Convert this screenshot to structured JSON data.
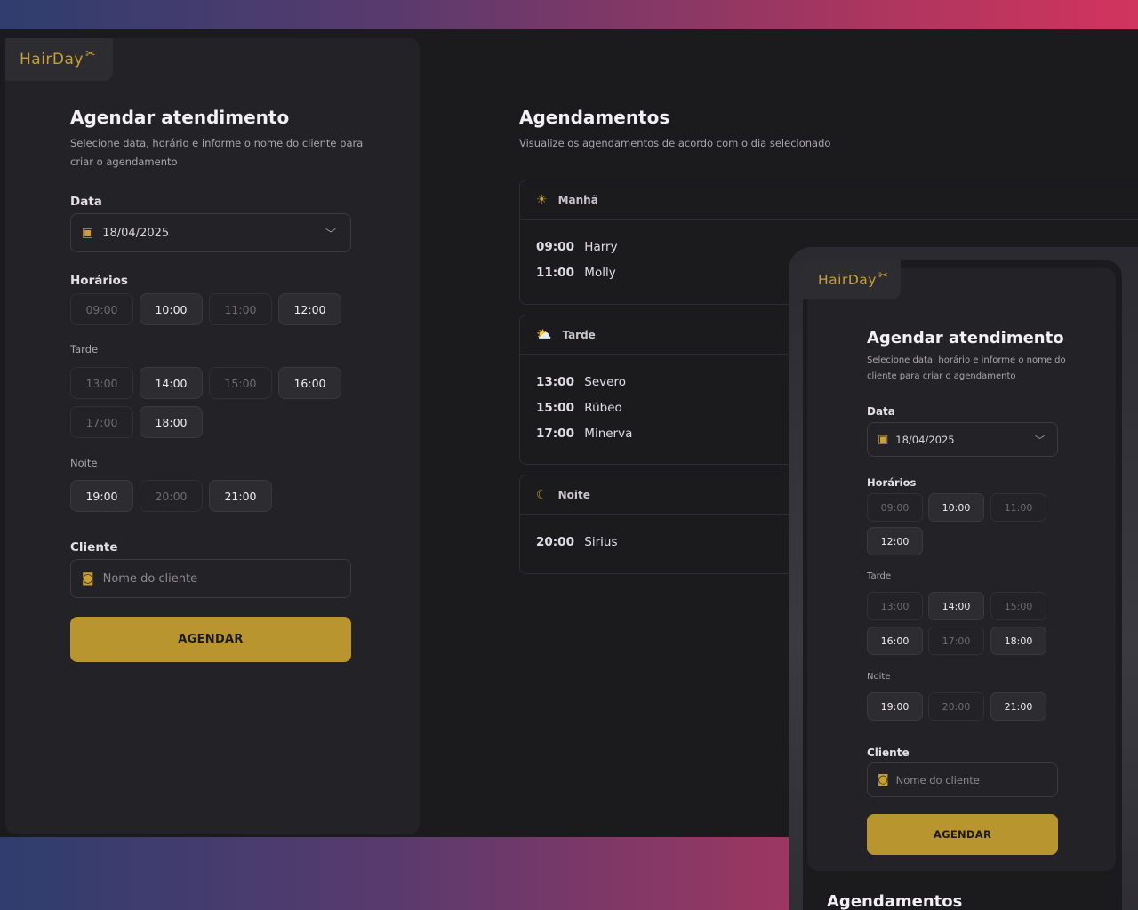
{
  "brand": {
    "name": "HairDay"
  },
  "form": {
    "title": "Agendar atendimento",
    "subtitle_line1": "Selecione data, horário e informe o nome do cliente para",
    "subtitle_line2": "criar o agendamento",
    "date_label": "Data",
    "date_value": "18/04/2025",
    "hours_label": "Horários",
    "afternoon_label": "Tarde",
    "night_label": "Noite",
    "morning_slots": [
      {
        "time": "09:00",
        "available": false
      },
      {
        "time": "10:00",
        "available": true
      },
      {
        "time": "11:00",
        "available": false
      },
      {
        "time": "12:00",
        "available": true
      }
    ],
    "afternoon_slots": [
      {
        "time": "13:00",
        "available": false
      },
      {
        "time": "14:00",
        "available": true
      },
      {
        "time": "15:00",
        "available": false
      },
      {
        "time": "16:00",
        "available": true
      },
      {
        "time": "17:00",
        "available": false
      },
      {
        "time": "18:00",
        "available": true
      }
    ],
    "night_slots": [
      {
        "time": "19:00",
        "available": true
      },
      {
        "time": "20:00",
        "available": false
      },
      {
        "time": "21:00",
        "available": true
      }
    ],
    "client_label": "Cliente",
    "client_placeholder": "Nome do cliente",
    "submit_label": "AGENDAR"
  },
  "schedule": {
    "title": "Agendamentos",
    "subtitle": "Visualize os agendamentos de acordo com o dia selecionado",
    "periods": [
      {
        "name": "Manhã",
        "icon": "sunrise-icon",
        "appointments": [
          {
            "time": "09:00",
            "client": "Harry"
          },
          {
            "time": "11:00",
            "client": "Molly"
          }
        ]
      },
      {
        "name": "Tarde",
        "icon": "cloud-sun-icon",
        "appointments": [
          {
            "time": "13:00",
            "client": "Severo"
          },
          {
            "time": "15:00",
            "client": "Rúbeo"
          },
          {
            "time": "17:00",
            "client": "Minerva"
          }
        ]
      },
      {
        "name": "Noite",
        "icon": "moon-icon",
        "appointments": [
          {
            "time": "20:00",
            "client": "Sirius"
          }
        ]
      }
    ]
  },
  "mobile": {
    "subtitle_line1": "Selecione data, horário e informe o nome do",
    "subtitle_line2": "cliente para criar o agendamento",
    "schedule_title": "Agendamentos"
  },
  "colors": {
    "accent": "#b8952e",
    "background": "#1b1a1d",
    "panel": "#232226",
    "gradient_start": "#2e3e6e",
    "gradient_end": "#d2345e"
  }
}
